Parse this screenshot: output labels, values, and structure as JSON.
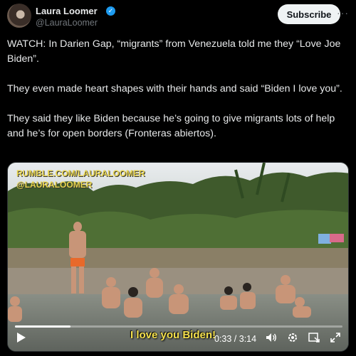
{
  "author": {
    "name": "Laura Loomer",
    "handle": "@LauraLoomer",
    "verified_mark": "✓"
  },
  "header": {
    "subscribe_label": "Subscribe",
    "more_icon": "···"
  },
  "tweet": {
    "paragraphs": [
      "WATCH: In Darien Gap, “migrants” from Venezuela told me they “Love Joe Biden”.",
      "They even made heart shapes with their hands and said “Biden I love you”.",
      "They said they like Biden because he’s going to give migrants lots of help and he’s for open borders (Fronteras abiertos)."
    ]
  },
  "video": {
    "watermark_1": "RUMBLE.COM/LAURALOOMER",
    "watermark_2": "@LAURALOOMER",
    "caption": "I love you Biden!",
    "time": "0:33 / 3:14",
    "progress": 0.17
  },
  "icons": {
    "play": "play-icon",
    "volume": "volume-icon",
    "settings": "gear-icon",
    "pip": "picture-in-picture-icon",
    "fullscreen": "fullscreen-icon"
  },
  "colors": {
    "background": "#000000",
    "text": "#e7e9ea",
    "secondary": "#71767b",
    "verified": "#1d9bf0",
    "caption": "#f4e04d"
  }
}
